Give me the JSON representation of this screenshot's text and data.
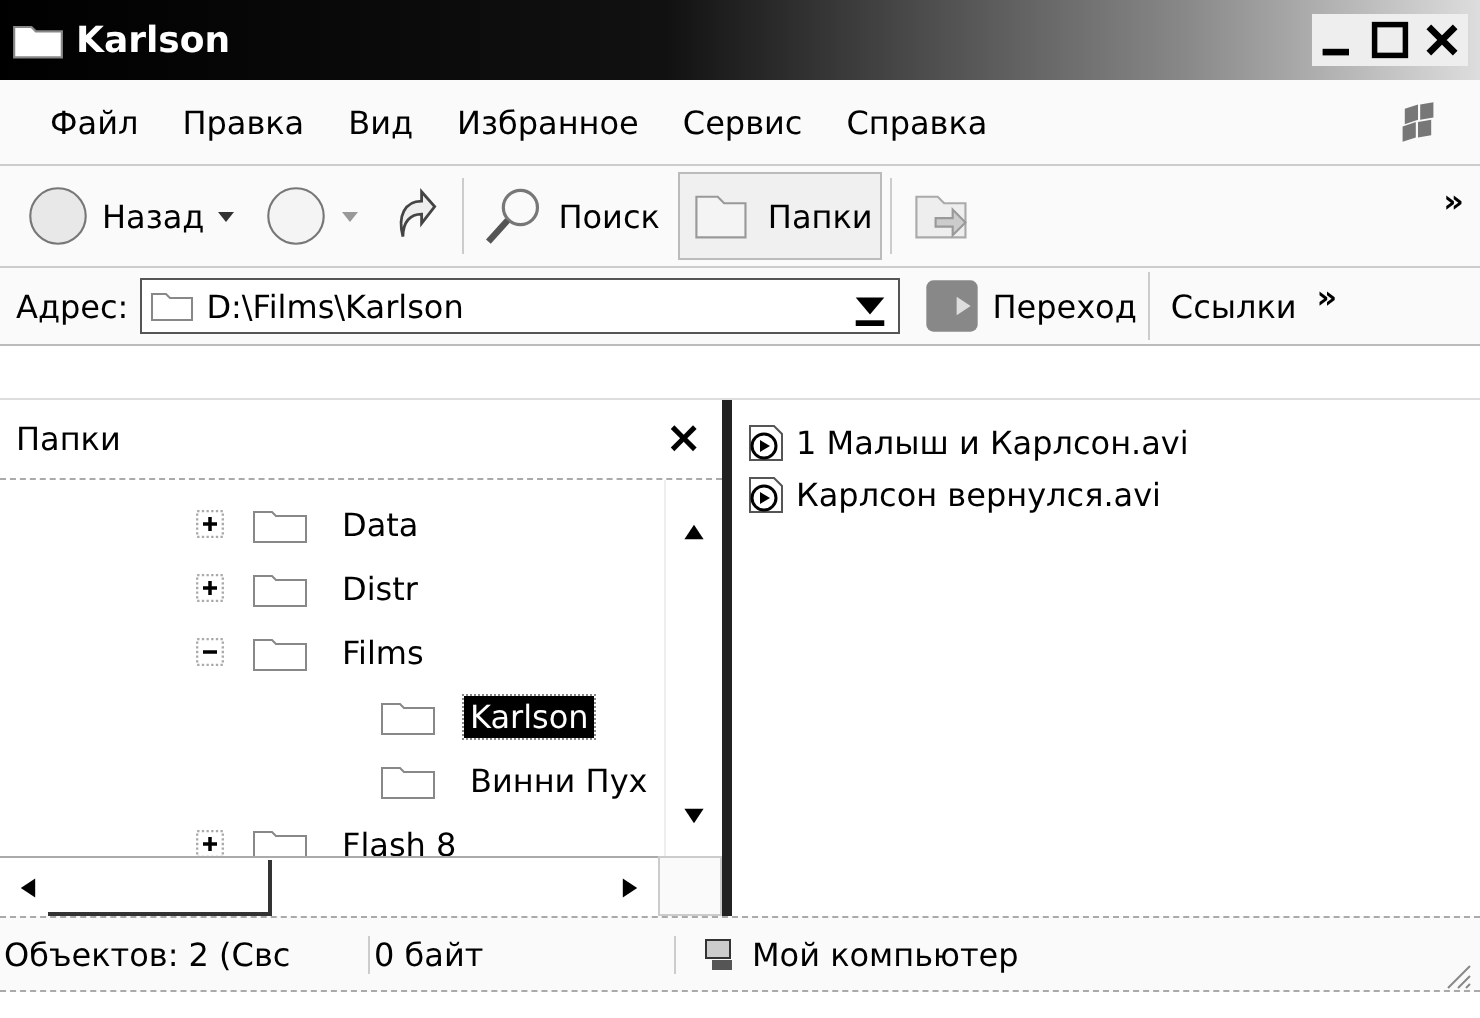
{
  "window": {
    "title": "Karlson"
  },
  "menu": [
    "Файл",
    "Правка",
    "Вид",
    "Избранное",
    "Сервис",
    "Справка"
  ],
  "toolbar": {
    "buttons": [
      {
        "kind": "back",
        "label": "Назад",
        "pressed": false
      },
      {
        "kind": "forward",
        "pressed": false
      },
      {
        "kind": "up",
        "pressed": false
      },
      {
        "kind": "search",
        "label": "Поиск",
        "pressed": false
      },
      {
        "kind": "folders",
        "label": "Папки",
        "pressed": true
      },
      {
        "kind": "move",
        "pressed": false
      }
    ],
    "more": "»"
  },
  "address_bar": {
    "label": "Адрес:",
    "value": "D:\\Films\\Karlson",
    "go": "Переход",
    "links": "Ссылки",
    "more": "»"
  },
  "folders_pane": {
    "title": "Папки",
    "close": "×",
    "tree": [
      {
        "name": "Data",
        "expanded": false,
        "selected": false
      },
      {
        "name": "Distr",
        "expanded": false,
        "selected": false
      },
      {
        "name": "Films",
        "expanded": true,
        "selected": false,
        "children": [
          {
            "name": "Karlson",
            "selected": true
          },
          {
            "name": "Винни Пух",
            "selected": false
          }
        ]
      },
      {
        "name": "Flash 8",
        "expanded": false,
        "selected": false
      }
    ]
  },
  "files": [
    {
      "name": "1 Малыш и Карлсон.avi",
      "selected": false
    },
    {
      "name": "Карлсон вернулся.avi",
      "selected": false
    }
  ],
  "status_bar": {
    "objects": "Объектов: 2 (Свс",
    "size": "0 байт",
    "zone": "Мой компьютер"
  }
}
